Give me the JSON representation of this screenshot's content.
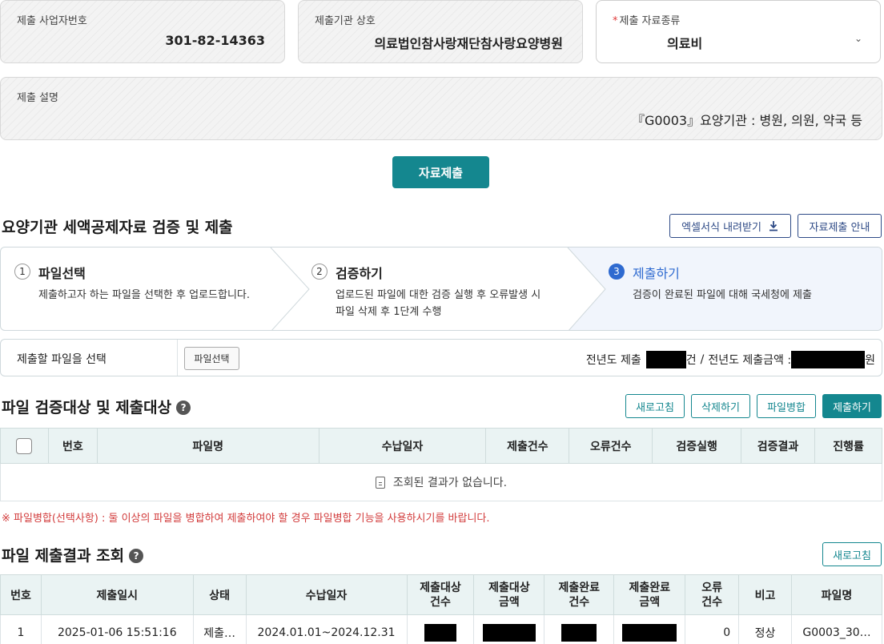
{
  "top_fields": {
    "business_no_label": "제출 사업자번호",
    "business_no_value": "301-82-14363",
    "org_name_label": "제출기관 상호",
    "org_name_value": "의료법인참사랑재단참사랑요양병원",
    "data_type_required_mark": "*",
    "data_type_label": "제출 자료종류",
    "data_type_value": "의료비",
    "description_label": "제출 설명",
    "description_value": "『G0003』요양기관 : 병원, 의원, 약국 등"
  },
  "submit_data_button": "자료제출",
  "validation_section": {
    "title": "요양기관 세액공제자료 검증 및 제출",
    "excel_download_button": "엑셀서식 내려받기",
    "guide_button": "자료제출 안내"
  },
  "steps": [
    {
      "num": "1",
      "title": "파일선택",
      "desc_line1": "제출하고자 하는 파일을 선택한 후 업로드합니다.",
      "desc_line2": ""
    },
    {
      "num": "2",
      "title": "검증하기",
      "desc_line1": "업로드된 파일에 대한 검증 실행 후 오류발생 시",
      "desc_line2": "파일 삭제 후 1단계 수행"
    },
    {
      "num": "3",
      "title": "제출하기",
      "desc_line1": "검증이 완료된 파일에 대해 국세청에 제출",
      "desc_line2": ""
    }
  ],
  "file_select": {
    "label": "제출할 파일을 선택",
    "button": "파일선택",
    "prev_year_count_label": "전년도 제출",
    "count_unit": "건",
    "separator": "/",
    "prev_year_amount_label": "전년도 제출금액 :",
    "amount_unit": "원"
  },
  "file_target_section": {
    "title": "파일 검증대상 및 제출대상",
    "help_icon": "?",
    "buttons": {
      "refresh": "새로고침",
      "delete": "삭제하기",
      "merge": "파일병합",
      "submit": "제출하기"
    },
    "columns": [
      "번호",
      "파일명",
      "수납일자",
      "제출건수",
      "오류건수",
      "검증실행",
      "검증결과",
      "진행률"
    ],
    "empty_message": "조회된 결과가 없습니다.",
    "notice": "※ 파일병합(선택사항) : 둘 이상의 파일을 병합하여 제출하여야 할 경우 파일병합 기능을 사용하시기를 바랍니다."
  },
  "result_section": {
    "title": "파일 제출결과 조회",
    "help_icon": "?",
    "refresh_button": "새로고침",
    "columns": [
      {
        "l1": "번호",
        "l2": ""
      },
      {
        "l1": "제출일시",
        "l2": ""
      },
      {
        "l1": "상태",
        "l2": ""
      },
      {
        "l1": "수납일자",
        "l2": ""
      },
      {
        "l1": "제출대상",
        "l2": "건수"
      },
      {
        "l1": "제출대상",
        "l2": "금액"
      },
      {
        "l1": "제출완료",
        "l2": "건수"
      },
      {
        "l1": "제출완료",
        "l2": "금액"
      },
      {
        "l1": "오류",
        "l2": "건수"
      },
      {
        "l1": "비고",
        "l2": ""
      },
      {
        "l1": "파일명",
        "l2": ""
      }
    ],
    "rows": [
      {
        "no": "1",
        "datetime": "2025-01-06 15:51:16",
        "status": "제출…",
        "period": "2024.01.01~2024.12.31",
        "errors": "0",
        "remark": "정상",
        "filename": "G0003_30…"
      }
    ]
  },
  "colors": {
    "teal": "#14878f",
    "navy": "#2e4a86",
    "active_step": "#2e6ad0",
    "notice_red": "#d23b3b"
  }
}
